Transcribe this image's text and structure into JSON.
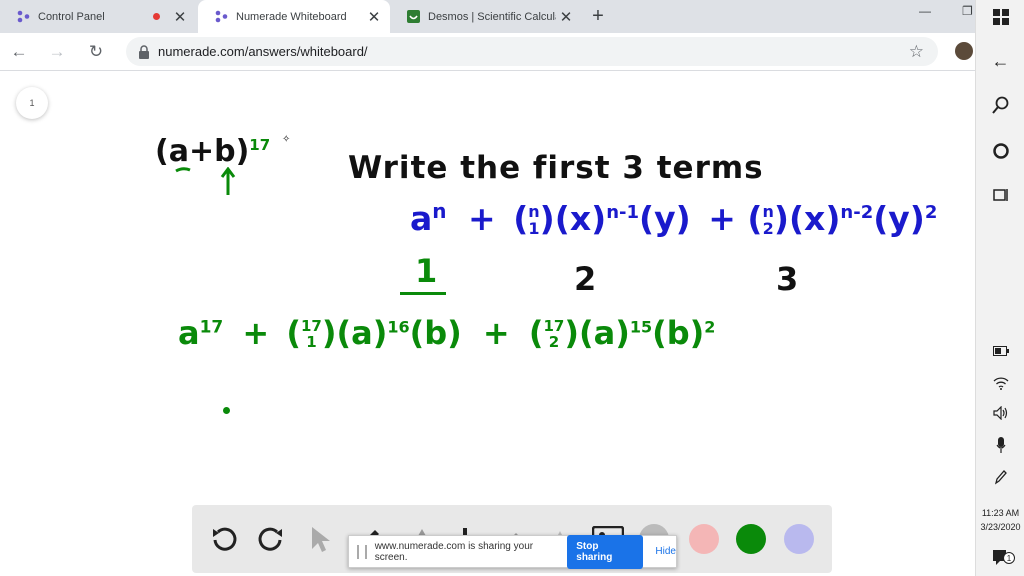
{
  "browser": {
    "tabs": [
      {
        "title": "Control Panel",
        "active": false
      },
      {
        "title": "Numerade Whiteboard",
        "active": true
      },
      {
        "title": "Desmos | Scientific Calculator",
        "active": false
      }
    ],
    "url": "numerade.com/answers/whiteboard/"
  },
  "whiteboard": {
    "page_number": "1",
    "problem": "(a+b)",
    "problem_exp": "17",
    "instruction": "Write the first 3 terms",
    "formula": {
      "t1": "a",
      "t1_exp": "n",
      "plus1": "+",
      "binom1_top": "n",
      "binom1_bot": "1",
      "x1": "(x)",
      "x1_exp": "n-1",
      "y1": "(y)",
      "plus2": "+",
      "binom2_top": "n",
      "binom2_bot": "2",
      "x2": "(x)",
      "x2_exp": "n-2",
      "y2": "(y)",
      "y2_exp": "2"
    },
    "term_numbers": [
      "1",
      "2",
      "3"
    ],
    "answer": {
      "t1": "a",
      "t1_exp": "17",
      "plus1": "+",
      "binom1_top": "17",
      "binom1_bot": "1",
      "a1": "(a)",
      "a1_exp": "16",
      "b1": "(b)",
      "plus2": "+",
      "binom2_top": "17",
      "binom2_bot": "2",
      "a2": "(a)",
      "a2_exp": "15",
      "b2": "(b)",
      "b2_exp": "2"
    }
  },
  "drawing_tools": {
    "colors": [
      "#bbbbbb",
      "#f4b6b6",
      "#0a8a0a",
      "#b9b9ee"
    ]
  },
  "share_bar": {
    "message": "www.numerade.com is sharing your screen.",
    "stop_label": "Stop sharing",
    "hide_label": "Hide"
  },
  "taskbar": {
    "time": "11:23 AM",
    "date": "3/23/2020",
    "notification_count": "1"
  }
}
